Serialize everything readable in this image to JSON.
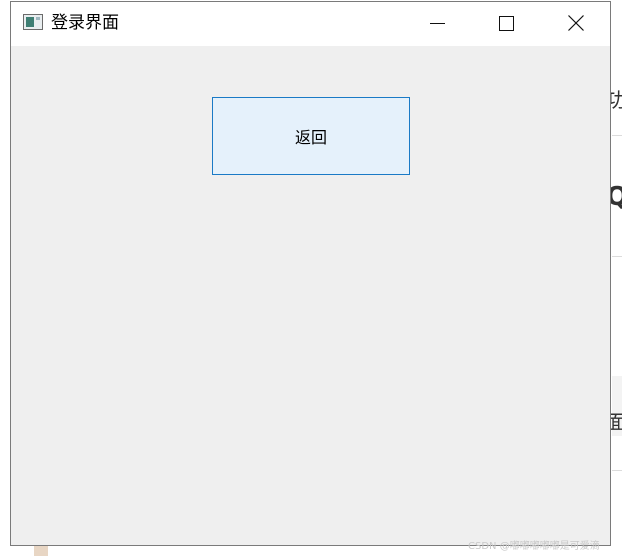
{
  "window": {
    "title": "登录界面"
  },
  "titlebar": {
    "icon": "app-window-icon",
    "minimize_icon": "minimize-icon",
    "maximize_icon": "maximize-icon",
    "close_icon": "close-icon"
  },
  "main": {
    "back_label": "返回",
    "back_button_border": "#1a7ac6",
    "back_button_fill": "#e5f1fb"
  },
  "background": {
    "glyph_1": "功",
    "glyph_2": "Q",
    "glyph_3": "面",
    "watermark": "CSDN @嘟嘟嘟嘟嘟是可爱滴"
  }
}
